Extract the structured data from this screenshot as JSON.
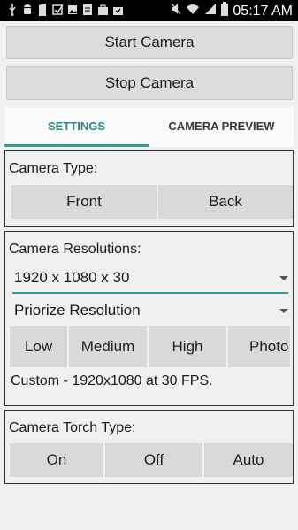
{
  "status": {
    "time": "05:17 AM",
    "left_icons": [
      "usb-icon",
      "android-icon",
      "sd-card-icon",
      "checkbox-icon",
      "image-icon",
      "note-icon",
      "briefcase-icon",
      "briefcase-check-icon"
    ],
    "right_icons": [
      "mute-icon",
      "wifi-icon",
      "signal-icon",
      "battery-icon"
    ]
  },
  "buttons": {
    "start": "Start Camera",
    "stop": "Stop Camera"
  },
  "tabs": [
    {
      "label": "SETTINGS",
      "active": true
    },
    {
      "label": "CAMERA PREVIEW",
      "active": false
    }
  ],
  "camera_type": {
    "label": "Camera Type:",
    "options": [
      "Front",
      "Back"
    ]
  },
  "resolutions": {
    "label": "Camera Resolutions:",
    "selected": "1920 x 1080 x 30",
    "priority": "Priorize Resolution",
    "presets": [
      "Low",
      "Medium",
      "High",
      "Photo"
    ],
    "custom_text": "Custom - 1920x1080 at 30 FPS."
  },
  "torch": {
    "label": "Camera Torch Type:",
    "options": [
      "On",
      "Off",
      "Auto"
    ]
  },
  "colors": {
    "accent": "#2a9d94",
    "tab_active_text": "#2a8a8a"
  }
}
